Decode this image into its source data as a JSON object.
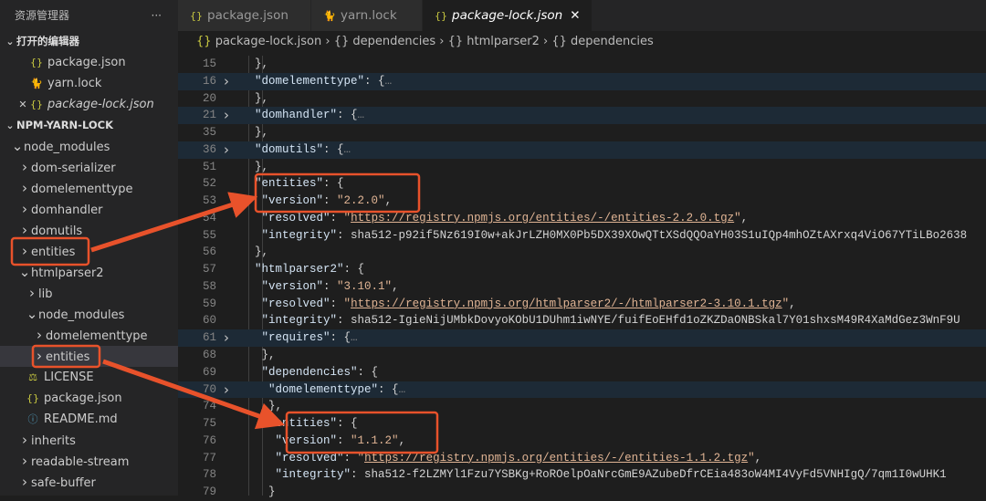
{
  "sidebar": {
    "title": "资源管理器",
    "more": "···",
    "open_editors": {
      "label": "打开的编辑器",
      "items": [
        {
          "label": "package.json",
          "icon": "json"
        },
        {
          "label": "yarn.lock",
          "icon": "yarn"
        },
        {
          "label": "package-lock.json",
          "icon": "json",
          "active": true
        }
      ]
    },
    "project": {
      "label": "NPM-YARN-LOCK",
      "tree": [
        {
          "label": "node_modules",
          "depth": 1,
          "chev": "open"
        },
        {
          "label": "dom-serializer",
          "depth": 2,
          "chev": "closed"
        },
        {
          "label": "domelementtype",
          "depth": 2,
          "chev": "closed"
        },
        {
          "label": "domhandler",
          "depth": 2,
          "chev": "closed"
        },
        {
          "label": "domutils",
          "depth": 2,
          "chev": "closed"
        },
        {
          "label": "entities",
          "depth": 2,
          "chev": "closed"
        },
        {
          "label": "htmlparser2",
          "depth": 2,
          "chev": "open"
        },
        {
          "label": "lib",
          "depth": 3,
          "chev": "closed"
        },
        {
          "label": "node_modules",
          "depth": 3,
          "chev": "open"
        },
        {
          "label": "domelementtype",
          "depth": 4,
          "chev": "closed"
        },
        {
          "label": "entities",
          "depth": 4,
          "chev": "closed",
          "selected": true
        },
        {
          "label": "LICENSE",
          "depth": 3,
          "icon": "lic"
        },
        {
          "label": "package.json",
          "depth": 3,
          "icon": "json"
        },
        {
          "label": "README.md",
          "depth": 3,
          "icon": "md"
        },
        {
          "label": "inherits",
          "depth": 2,
          "chev": "closed"
        },
        {
          "label": "readable-stream",
          "depth": 2,
          "chev": "closed"
        },
        {
          "label": "safe-buffer",
          "depth": 2,
          "chev": "closed"
        }
      ]
    }
  },
  "tabs": [
    {
      "label": "package.json",
      "icon": "json"
    },
    {
      "label": "yarn.lock",
      "icon": "yarn"
    },
    {
      "label": "package-lock.json",
      "icon": "json",
      "active": true,
      "close": "✕"
    }
  ],
  "breadcrumb": [
    "package-lock.json",
    "dependencies",
    "htmlparser2",
    "dependencies"
  ],
  "code": [
    {
      "n": "15",
      "i": 2,
      "t": "},"
    },
    {
      "n": "16",
      "i": 2,
      "t": "\"domelementtype\": {…",
      "fold": true
    },
    {
      "n": "20",
      "i": 2,
      "t": "},"
    },
    {
      "n": "21",
      "i": 2,
      "t": "\"domhandler\": {…",
      "fold": true
    },
    {
      "n": "35",
      "i": 2,
      "t": "},"
    },
    {
      "n": "36",
      "i": 2,
      "t": "\"domutils\": {…",
      "fold": true
    },
    {
      "n": "51",
      "i": 2,
      "t": "},"
    },
    {
      "n": "52",
      "i": 2,
      "t": "\"entities\": {"
    },
    {
      "n": "53",
      "i": 3,
      "t": "\"version\": \"2.2.0\","
    },
    {
      "n": "54",
      "i": 3,
      "t": "\"resolved\": \"https://registry.npmjs.org/entities/-/entities-2.2.0.tgz\","
    },
    {
      "n": "55",
      "i": 3,
      "t": "\"integrity\": \"sha512-p92if5Nz619I0w+akJrLZH0MX0Pb5DX39XOwQTtXSdQQOaYH03S1uIQp4mhOZtAXrxq4ViO67YTiLBo2638"
    },
    {
      "n": "56",
      "i": 2,
      "t": "},"
    },
    {
      "n": "57",
      "i": 2,
      "t": "\"htmlparser2\": {"
    },
    {
      "n": "58",
      "i": 3,
      "t": "\"version\": \"3.10.1\","
    },
    {
      "n": "59",
      "i": 3,
      "t": "\"resolved\": \"https://registry.npmjs.org/htmlparser2/-/htmlparser2-3.10.1.tgz\","
    },
    {
      "n": "60",
      "i": 3,
      "t": "\"integrity\": \"sha512-IgieNijUMbkDovyoKObU1DUhm1iwNYE/fuifEoEHfd1oZKZDaONBSkal7Y01shxsM49R4XaMdGez3WnF9U"
    },
    {
      "n": "61",
      "i": 3,
      "t": "\"requires\": {…",
      "fold": true
    },
    {
      "n": "68",
      "i": 3,
      "t": "},"
    },
    {
      "n": "69",
      "i": 3,
      "t": "\"dependencies\": {"
    },
    {
      "n": "70",
      "i": 4,
      "t": "\"domelementtype\": {…",
      "fold": true
    },
    {
      "n": "74",
      "i": 4,
      "t": "},"
    },
    {
      "n": "75",
      "i": 4,
      "t": "\"entities\": {"
    },
    {
      "n": "76",
      "i": 5,
      "t": "\"version\": \"1.1.2\","
    },
    {
      "n": "77",
      "i": 5,
      "t": "\"resolved\": \"https://registry.npmjs.org/entities/-/entities-1.1.2.tgz\","
    },
    {
      "n": "78",
      "i": 5,
      "t": "\"integrity\": \"sha512-f2LZMYl1Fzu7YSBKg+RoROelpOaNrcGmE9AZubeDfrCEia483oW4MI4VyFd5VNHIgQ/7qm1I0wUHK1"
    },
    {
      "n": "79",
      "i": 4,
      "t": "}"
    }
  ],
  "annotation_color": "#e8522b"
}
